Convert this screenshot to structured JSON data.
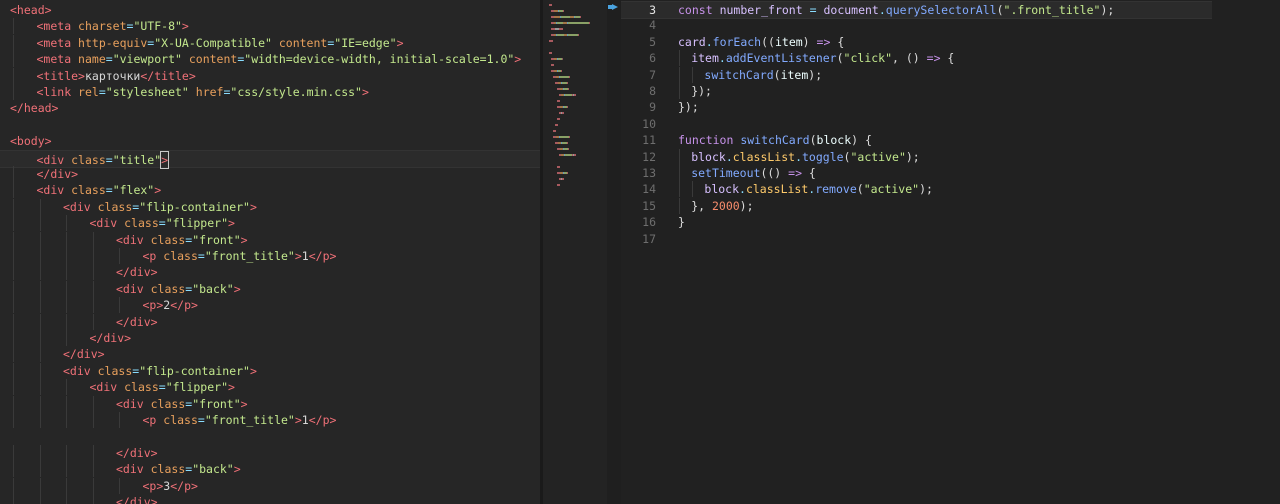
{
  "left_editor": {
    "lines": [
      {
        "indent": 0,
        "tokens": [
          [
            "tag",
            "<head>"
          ]
        ]
      },
      {
        "indent": 1,
        "tokens": [
          [
            "tag",
            "<meta "
          ],
          [
            "attr",
            "charset"
          ],
          [
            "punc",
            "="
          ],
          [
            "str",
            "\"UTF-8\""
          ],
          [
            "tag",
            ">"
          ]
        ]
      },
      {
        "indent": 1,
        "tokens": [
          [
            "tag",
            "<meta "
          ],
          [
            "attr",
            "http-equiv"
          ],
          [
            "punc",
            "="
          ],
          [
            "str",
            "\"X-UA-Compatible\""
          ],
          [
            "attr",
            " content"
          ],
          [
            "punc",
            "="
          ],
          [
            "str",
            "\"IE=edge\""
          ],
          [
            "tag",
            ">"
          ]
        ]
      },
      {
        "indent": 1,
        "tokens": [
          [
            "tag",
            "<meta "
          ],
          [
            "attr",
            "name"
          ],
          [
            "punc",
            "="
          ],
          [
            "str",
            "\"viewport\""
          ],
          [
            "attr",
            " content"
          ],
          [
            "punc",
            "="
          ],
          [
            "str",
            "\"width=device-width, initial-scale=1.0\""
          ],
          [
            "tag",
            ">"
          ]
        ]
      },
      {
        "indent": 1,
        "tokens": [
          [
            "tag",
            "<title>"
          ],
          [
            "text",
            "карточки"
          ],
          [
            "tag",
            "</title>"
          ]
        ]
      },
      {
        "indent": 1,
        "tokens": [
          [
            "tag",
            "<link "
          ],
          [
            "attr",
            "rel"
          ],
          [
            "punc",
            "="
          ],
          [
            "str",
            "\"stylesheet\""
          ],
          [
            "attr",
            " href"
          ],
          [
            "punc",
            "="
          ],
          [
            "str",
            "\"css/style.min.css\""
          ],
          [
            "tag",
            ">"
          ]
        ]
      },
      {
        "indent": 0,
        "tokens": [
          [
            "tag",
            "</head>"
          ]
        ]
      },
      {
        "indent": 0,
        "tokens": []
      },
      {
        "indent": 0,
        "tokens": [
          [
            "tag",
            "<body>"
          ]
        ]
      },
      {
        "indent": 1,
        "cursor": true,
        "tokens": [
          [
            "tag",
            "<div "
          ],
          [
            "attr",
            "class"
          ],
          [
            "punc",
            "="
          ],
          [
            "str",
            "\"title\""
          ],
          [
            "caret",
            ">"
          ]
        ]
      },
      {
        "indent": 1,
        "tokens": [
          [
            "tag",
            "</div>"
          ]
        ]
      },
      {
        "indent": 1,
        "tokens": [
          [
            "tag",
            "<div "
          ],
          [
            "attr",
            "class"
          ],
          [
            "punc",
            "="
          ],
          [
            "str",
            "\"flex\""
          ],
          [
            "tag",
            ">"
          ]
        ]
      },
      {
        "indent": 2,
        "tokens": [
          [
            "tag",
            "<div "
          ],
          [
            "attr",
            "class"
          ],
          [
            "punc",
            "="
          ],
          [
            "str",
            "\"flip-container\""
          ],
          [
            "tag",
            ">"
          ]
        ]
      },
      {
        "indent": 3,
        "tokens": [
          [
            "tag",
            "<div "
          ],
          [
            "attr",
            "class"
          ],
          [
            "punc",
            "="
          ],
          [
            "str",
            "\"flipper\""
          ],
          [
            "tag",
            ">"
          ]
        ]
      },
      {
        "indent": 4,
        "tokens": [
          [
            "tag",
            "<div "
          ],
          [
            "attr",
            "class"
          ],
          [
            "punc",
            "="
          ],
          [
            "str",
            "\"front\""
          ],
          [
            "tag",
            ">"
          ]
        ]
      },
      {
        "indent": 5,
        "tokens": [
          [
            "tag",
            "<p "
          ],
          [
            "attr",
            "class"
          ],
          [
            "punc",
            "="
          ],
          [
            "str",
            "\"front_title\""
          ],
          [
            "tag",
            ">"
          ],
          [
            "text",
            "1"
          ],
          [
            "tag",
            "</p>"
          ]
        ]
      },
      {
        "indent": 4,
        "tokens": [
          [
            "tag",
            "</div>"
          ]
        ]
      },
      {
        "indent": 4,
        "tokens": [
          [
            "tag",
            "<div "
          ],
          [
            "attr",
            "class"
          ],
          [
            "punc",
            "="
          ],
          [
            "str",
            "\"back\""
          ],
          [
            "tag",
            ">"
          ]
        ]
      },
      {
        "indent": 5,
        "tokens": [
          [
            "tag",
            "<p>"
          ],
          [
            "text",
            "2"
          ],
          [
            "tag",
            "</p>"
          ]
        ]
      },
      {
        "indent": 4,
        "tokens": [
          [
            "tag",
            "</div>"
          ]
        ]
      },
      {
        "indent": 3,
        "tokens": [
          [
            "tag",
            "</div>"
          ]
        ]
      },
      {
        "indent": 2,
        "tokens": [
          [
            "tag",
            "</div>"
          ]
        ]
      },
      {
        "indent": 2,
        "tokens": [
          [
            "tag",
            "<div "
          ],
          [
            "attr",
            "class"
          ],
          [
            "punc",
            "="
          ],
          [
            "str",
            "\"flip-container\""
          ],
          [
            "tag",
            ">"
          ]
        ]
      },
      {
        "indent": 3,
        "tokens": [
          [
            "tag",
            "<div "
          ],
          [
            "attr",
            "class"
          ],
          [
            "punc",
            "="
          ],
          [
            "str",
            "\"flipper\""
          ],
          [
            "tag",
            ">"
          ]
        ]
      },
      {
        "indent": 4,
        "tokens": [
          [
            "tag",
            "<div "
          ],
          [
            "attr",
            "class"
          ],
          [
            "punc",
            "="
          ],
          [
            "str",
            "\"front\""
          ],
          [
            "tag",
            ">"
          ]
        ]
      },
      {
        "indent": 5,
        "tokens": [
          [
            "tag",
            "<p "
          ],
          [
            "attr",
            "class"
          ],
          [
            "punc",
            "="
          ],
          [
            "str",
            "\"front_title\""
          ],
          [
            "tag",
            ">"
          ],
          [
            "text",
            "1"
          ],
          [
            "tag",
            "</p>"
          ]
        ]
      },
      {
        "indent": 0,
        "tokens": []
      },
      {
        "indent": 4,
        "tokens": [
          [
            "tag",
            "</div>"
          ]
        ]
      },
      {
        "indent": 4,
        "tokens": [
          [
            "tag",
            "<div "
          ],
          [
            "attr",
            "class"
          ],
          [
            "punc",
            "="
          ],
          [
            "str",
            "\"back\""
          ],
          [
            "tag",
            ">"
          ]
        ]
      },
      {
        "indent": 5,
        "tokens": [
          [
            "tag",
            "<p>"
          ],
          [
            "text",
            "3"
          ],
          [
            "tag",
            "</p>"
          ]
        ]
      },
      {
        "indent": 4,
        "tokens": [
          [
            "tag",
            "</div>"
          ]
        ]
      }
    ]
  },
  "right_editor": {
    "active_line": "3",
    "lines": [
      {
        "num": "3",
        "indent": 0,
        "tokens": [
          [
            "kw",
            "const"
          ],
          [
            "plain",
            " "
          ],
          [
            "var",
            "number_front"
          ],
          [
            "plain",
            " "
          ],
          [
            "punc",
            "="
          ],
          [
            "plain",
            " "
          ],
          [
            "var",
            "document"
          ],
          [
            "punc",
            "."
          ],
          [
            "fn",
            "querySelectorAll"
          ],
          [
            "plain",
            "("
          ],
          [
            "str",
            "\".front_title\""
          ],
          [
            "plain",
            ");"
          ]
        ]
      },
      {
        "num": "4",
        "indent": 0,
        "tokens": []
      },
      {
        "num": "5",
        "indent": 0,
        "tokens": [
          [
            "var",
            "card"
          ],
          [
            "punc",
            "."
          ],
          [
            "fn",
            "forEach"
          ],
          [
            "plain",
            "(("
          ],
          [
            "param",
            "item"
          ],
          [
            "plain",
            ") "
          ],
          [
            "kw",
            "=>"
          ],
          [
            "plain",
            " {"
          ]
        ]
      },
      {
        "num": "6",
        "indent": 1,
        "tokens": [
          [
            "var",
            "item"
          ],
          [
            "punc",
            "."
          ],
          [
            "fn",
            "addEventListener"
          ],
          [
            "plain",
            "("
          ],
          [
            "str",
            "\"click\""
          ],
          [
            "plain",
            ", () "
          ],
          [
            "kw",
            "=>"
          ],
          [
            "plain",
            " {"
          ]
        ]
      },
      {
        "num": "7",
        "indent": 2,
        "tokens": [
          [
            "fn",
            "switchCard"
          ],
          [
            "plain",
            "("
          ],
          [
            "param",
            "item"
          ],
          [
            "plain",
            ");"
          ]
        ]
      },
      {
        "num": "8",
        "indent": 1,
        "tokens": [
          [
            "plain",
            "});"
          ]
        ]
      },
      {
        "num": "9",
        "indent": 0,
        "tokens": [
          [
            "plain",
            "});"
          ]
        ]
      },
      {
        "num": "10",
        "indent": 0,
        "tokens": []
      },
      {
        "num": "11",
        "indent": 0,
        "tokens": [
          [
            "kw",
            "function"
          ],
          [
            "plain",
            " "
          ],
          [
            "fn",
            "switchCard"
          ],
          [
            "plain",
            "("
          ],
          [
            "param",
            "block"
          ],
          [
            "plain",
            ") {"
          ]
        ]
      },
      {
        "num": "12",
        "indent": 1,
        "tokens": [
          [
            "var",
            "block"
          ],
          [
            "punc",
            "."
          ],
          [
            "prop",
            "classList"
          ],
          [
            "punc",
            "."
          ],
          [
            "fn",
            "toggle"
          ],
          [
            "plain",
            "("
          ],
          [
            "str",
            "\"active\""
          ],
          [
            "plain",
            ");"
          ]
        ]
      },
      {
        "num": "13",
        "indent": 1,
        "tokens": [
          [
            "fn",
            "setTimeout"
          ],
          [
            "plain",
            "(() "
          ],
          [
            "kw",
            "=>"
          ],
          [
            "plain",
            " {"
          ]
        ]
      },
      {
        "num": "14",
        "indent": 2,
        "tokens": [
          [
            "var",
            "block"
          ],
          [
            "punc",
            "."
          ],
          [
            "prop",
            "classList"
          ],
          [
            "punc",
            "."
          ],
          [
            "fn",
            "remove"
          ],
          [
            "plain",
            "("
          ],
          [
            "str",
            "\"active\""
          ],
          [
            "plain",
            ");"
          ]
        ]
      },
      {
        "num": "15",
        "indent": 1,
        "tokens": [
          [
            "plain",
            "}, "
          ],
          [
            "num",
            "2000"
          ],
          [
            "plain",
            ");"
          ]
        ]
      },
      {
        "num": "16",
        "indent": 0,
        "tokens": [
          [
            "plain",
            "}"
          ]
        ]
      },
      {
        "num": "17",
        "indent": 0,
        "tokens": []
      }
    ]
  },
  "colors": {
    "background": "#262626",
    "tag": "#f07178",
    "attribute": "#e8a05d",
    "string": "#c3e88d",
    "function": "#82aaff",
    "keyword": "#c792ea"
  },
  "icons": {
    "gutter_marker": "bookmark-icon"
  }
}
